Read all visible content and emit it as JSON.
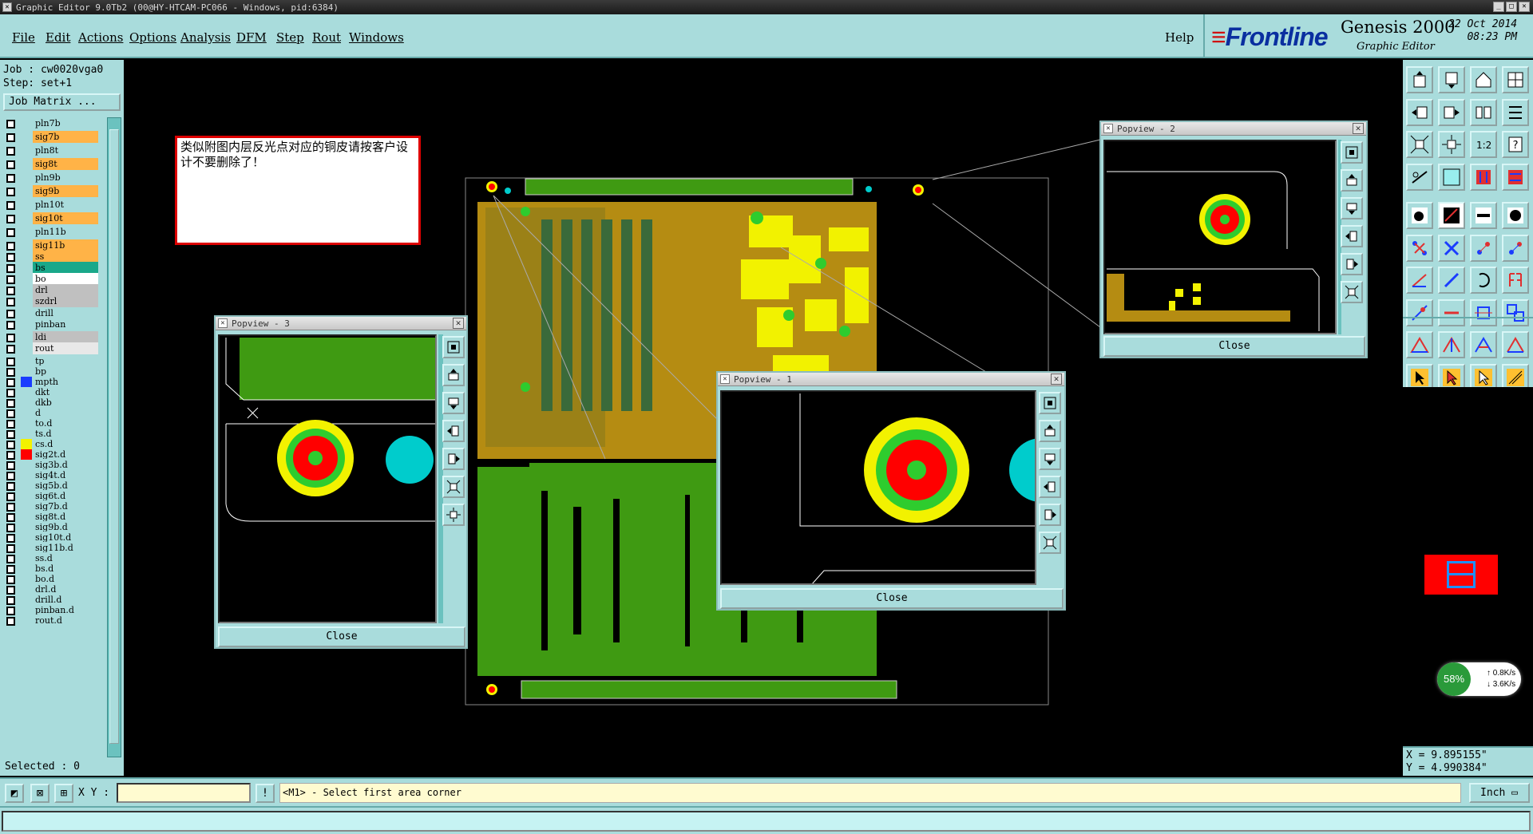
{
  "window": {
    "title": "Graphic Editor 9.0Tb2 (00@HY-HTCAM-PC066 - Windows, pid:6384)"
  },
  "menu": [
    "File",
    "Edit",
    "Actions",
    "Options",
    "Analysis",
    "DFM",
    "Step",
    "Rout",
    "Windows"
  ],
  "help_label": "Help",
  "brand": {
    "logo": "Frontline",
    "product": "Genesis 2000",
    "subtitle": "Graphic Editor",
    "date": "22 Oct 2014",
    "time": "08:23 PM"
  },
  "job": {
    "job_line": "Job : cw0020vga0",
    "step_line": "Step: set+1",
    "job_matrix": "Job Matrix ..."
  },
  "layers": [
    {
      "name": "pln7b",
      "color": "#a9dcdc"
    },
    {
      "name": "sig7b",
      "color": "#ffb347"
    },
    {
      "name": "pln8t",
      "color": "#a9dcdc"
    },
    {
      "name": "sig8t",
      "color": "#ffb347"
    },
    {
      "name": "pln9b",
      "color": "#a9dcdc"
    },
    {
      "name": "sig9b",
      "color": "#ffb347"
    },
    {
      "name": "pln10t",
      "color": "#a9dcdc"
    },
    {
      "name": "sig10t",
      "color": "#ffb347"
    },
    {
      "name": "pln11b",
      "color": "#a9dcdc"
    },
    {
      "name": "sig11b",
      "color": "#ffb347"
    },
    {
      "name": "ss",
      "color": "#ffb347"
    },
    {
      "name": "bs",
      "color": "#1aa88a"
    },
    {
      "name": "bo",
      "color": "#ffffff"
    },
    {
      "name": "drl",
      "color": "#c0c0c0"
    },
    {
      "name": "szdrl",
      "color": "#c0c0c0"
    },
    {
      "name": "drill",
      "color": "#a9dcdc"
    },
    {
      "name": "pinban",
      "color": "#a9dcdc"
    },
    {
      "name": "ldi",
      "color": "#c0c0c0"
    },
    {
      "name": "rout",
      "color": "#e8e8e8"
    },
    {
      "name": "tp",
      "color": "#a9dcdc"
    },
    {
      "name": "bp",
      "color": "#a9dcdc"
    },
    {
      "name": "mpth",
      "color": "#a9dcdc"
    },
    {
      "name": "dkt",
      "color": "#a9dcdc"
    },
    {
      "name": "dkb",
      "color": "#a9dcdc"
    },
    {
      "name": "d",
      "color": "#a9dcdc"
    },
    {
      "name": "to.d",
      "color": "#a9dcdc"
    },
    {
      "name": "ts.d",
      "color": "#a9dcdc"
    },
    {
      "name": "cs.d",
      "color": "#a9dcdc"
    },
    {
      "name": "sig2t.d",
      "color": "#a9dcdc"
    },
    {
      "name": "sig3b.d",
      "color": "#a9dcdc"
    },
    {
      "name": "sig4t.d",
      "color": "#a9dcdc"
    },
    {
      "name": "sig5b.d",
      "color": "#a9dcdc"
    },
    {
      "name": "sig6t.d",
      "color": "#a9dcdc"
    },
    {
      "name": "sig7b.d",
      "color": "#a9dcdc"
    },
    {
      "name": "sig8t.d",
      "color": "#a9dcdc"
    },
    {
      "name": "sig9b.d",
      "color": "#a9dcdc"
    },
    {
      "name": "sig10t.d",
      "color": "#a9dcdc"
    },
    {
      "name": "sig11b.d",
      "color": "#a9dcdc"
    },
    {
      "name": "ss.d",
      "color": "#a9dcdc"
    },
    {
      "name": "bs.d",
      "color": "#a9dcdc"
    },
    {
      "name": "bo.d",
      "color": "#a9dcdc"
    },
    {
      "name": "drl.d",
      "color": "#a9dcdc"
    },
    {
      "name": "drill.d",
      "color": "#a9dcdc"
    },
    {
      "name": "pinban.d",
      "color": "#a9dcdc"
    },
    {
      "name": "rout.d",
      "color": "#a9dcdc"
    }
  ],
  "selected": "Selected : 0",
  "note": "类似附图内层反光点对应的铜皮请按客户设计不要删除了！",
  "popviews": [
    {
      "title": "Popview - 3",
      "close": "Close"
    },
    {
      "title": "Popview - 2",
      "close": "Close"
    },
    {
      "title": "Popview - 1",
      "close": "Close"
    }
  ],
  "coords": {
    "x": "X = 9.895155\"",
    "y": "Y = 4.990384\""
  },
  "netmeter": {
    "percent": "58%",
    "up": "0.8K/s",
    "down": "3.6K/s"
  },
  "statusbar": {
    "xy_label": "X Y :",
    "prompt": "<M1> - Select first area corner",
    "units": "Inch"
  },
  "colors": {
    "panel": "#a9dcdc",
    "canvas": "#000000",
    "board_green": "#3f9a12",
    "board_yellow": "#f2f200",
    "pad_red": "#ff0000",
    "pad_cyan": "#00cccc"
  }
}
